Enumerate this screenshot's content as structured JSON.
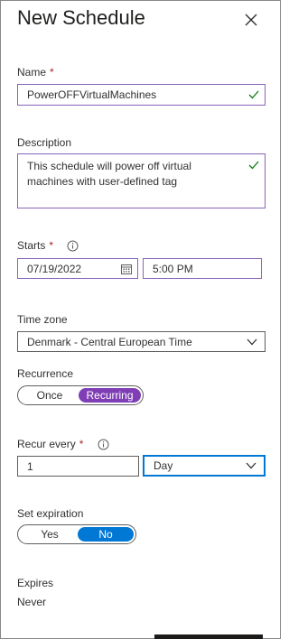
{
  "header": {
    "title": "New Schedule",
    "close_icon": "close-icon"
  },
  "name": {
    "label": "Name",
    "required": "*",
    "value": "PowerOFFVirtualMachines"
  },
  "description": {
    "label": "Description",
    "value_line1": "This schedule will power off virtual",
    "value_line2": "machines with user-defined tag"
  },
  "starts": {
    "label": "Starts",
    "required": "*",
    "date": "07/19/2022",
    "time": "5:00 PM"
  },
  "timezone": {
    "label": "Time zone",
    "value": "Denmark - Central European Time"
  },
  "recurrence": {
    "label": "Recurrence",
    "options": [
      "Once",
      "Recurring"
    ],
    "selected": "Recurring"
  },
  "recur_every": {
    "label": "Recur every",
    "required": "*",
    "value": "1",
    "unit": "Day"
  },
  "expiration": {
    "label": "Set expiration",
    "options": [
      "Yes",
      "No"
    ],
    "selected": "No"
  },
  "expires": {
    "label": "Expires",
    "value": "Never"
  },
  "colors": {
    "accent_purple": "#7f3db6",
    "accent_blue": "#0078d4",
    "valid_green": "#107c10",
    "required_red": "#a4262c"
  }
}
